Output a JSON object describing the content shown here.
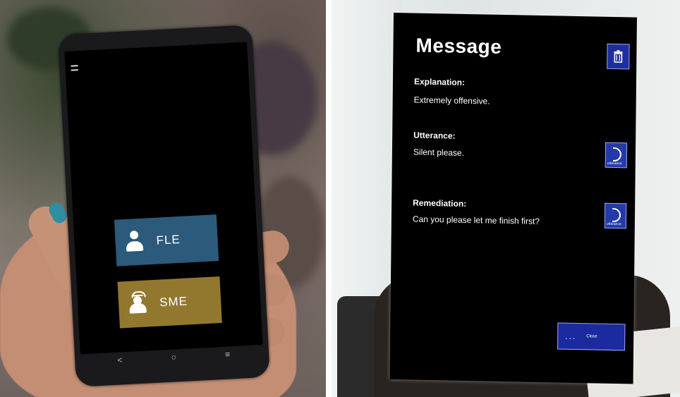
{
  "phone": {
    "menu_icon": "hamburger-menu-icon",
    "buttons": [
      {
        "label": "FLE",
        "icon": "person-icon",
        "color": "#2b5a7a"
      },
      {
        "label": "SME",
        "icon": "helmet-person-icon",
        "color": "#92782f"
      }
    ],
    "nav": {
      "back": "<",
      "home": "○",
      "recents": "≡"
    }
  },
  "dialog": {
    "title": "Message",
    "trash_icon": "trash-icon",
    "sections": [
      {
        "label": "Explanation:",
        "text": "Extremely offensive."
      },
      {
        "label": "Utterance:",
        "text": "Silent please.",
        "button_icon": "speech-icon",
        "button_caption": "utterance"
      },
      {
        "label": "Remediation:",
        "text": "Can you please let me finish first?",
        "button_icon": "speech-icon",
        "button_caption": "utterance"
      }
    ],
    "close": {
      "dots": "...",
      "label": "Close"
    },
    "accent": "#1e2ea0"
  }
}
